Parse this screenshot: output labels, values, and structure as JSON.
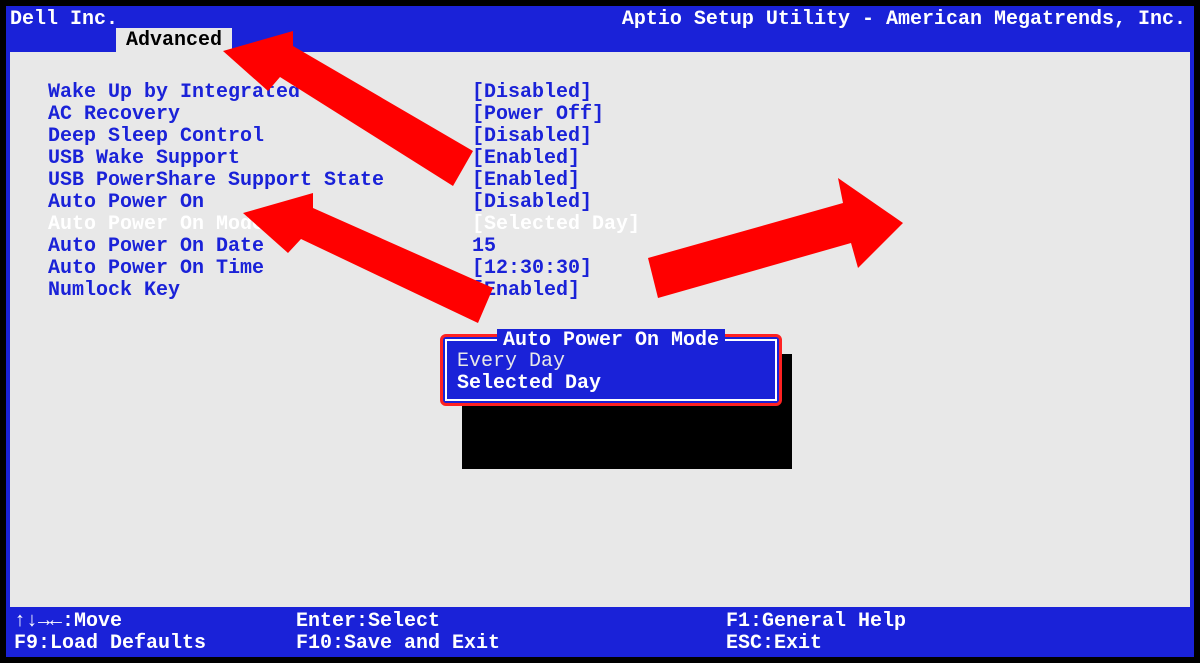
{
  "header": {
    "vendor": "Dell Inc.",
    "utility": "Aptio Setup Utility - American Megatrends, Inc.",
    "active_tab": "Advanced"
  },
  "settings": [
    {
      "label": "Wake Up by Integrated LAN",
      "value": "[Disabled]",
      "highlight": false
    },
    {
      "label": "AC Recovery",
      "value": "[Power Off]",
      "highlight": false
    },
    {
      "label": "Deep Sleep Control",
      "value": "[Disabled]",
      "highlight": false
    },
    {
      "label": "USB Wake Support",
      "value": "[Enabled]",
      "highlight": false
    },
    {
      "label": "USB PowerShare Support State",
      "value": "[Enabled]",
      "highlight": false
    },
    {
      "label": "Auto Power On",
      "value": "[Disabled]",
      "highlight": false
    },
    {
      "label": "Auto Power On Mode",
      "value": "[Selected Day]",
      "highlight": true
    },
    {
      "label": "Auto Power On Date",
      "value": "15",
      "highlight": false
    },
    {
      "label": "Auto Power On Time",
      "value": "[12:30:30]",
      "highlight": false
    },
    {
      "label": "Numlock Key",
      "value": "[Enabled]",
      "highlight": false
    }
  ],
  "popup": {
    "title": "Auto Power On Mode",
    "options": [
      {
        "label": "Every Day",
        "selected": false
      },
      {
        "label": "Selected Day",
        "selected": true
      }
    ]
  },
  "footer": {
    "move": "↑↓→←:Move",
    "load_defaults": "F9:Load Defaults",
    "select": "Enter:Select",
    "save_exit": "F10:Save and Exit",
    "help": "F1:General Help",
    "exit": "ESC:Exit"
  }
}
